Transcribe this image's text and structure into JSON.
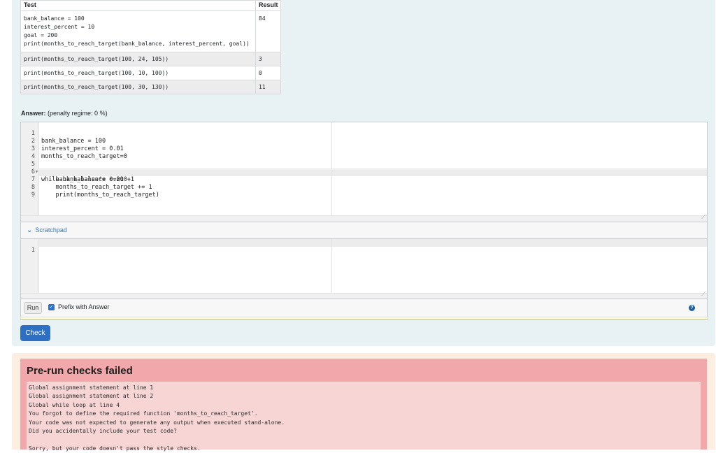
{
  "test_table": {
    "headers": {
      "test": "Test",
      "result": "Result"
    },
    "rows": [
      {
        "test": "bank_balance = 100\ninterest_percent = 10\ngoal = 200\nprint(months_to_reach_target(bank_balance, interest_percent, goal))",
        "result": "84"
      },
      {
        "test": "print(months_to_reach_target(100, 24, 105))",
        "result": "3"
      },
      {
        "test": "print(months_to_reach_target(100, 10, 100))",
        "result": "0"
      },
      {
        "test": "print(months_to_reach_target(100, 30, 130))",
        "result": "11"
      }
    ]
  },
  "answer": {
    "label": "Answer:",
    "penalty": "(penalty regime: 0 %)"
  },
  "editor": {
    "lines": [
      {
        "n": "1",
        "fold": "",
        "text": "bank_balance = 100"
      },
      {
        "n": "2",
        "fold": "",
        "text": "interest_percent = 0.01"
      },
      {
        "n": "3",
        "fold": "",
        "text": "months_to_reach_target=0"
      },
      {
        "n": "4",
        "fold": "",
        "text": ""
      },
      {
        "n": "5",
        "fold": "▾",
        "text": "while bank_balance <=200:"
      },
      {
        "n": "6",
        "fold": "",
        "text": "    bank_balance*= 0.01 +1"
      },
      {
        "n": "7",
        "fold": "",
        "text": "    months_to_reach_target += 1"
      },
      {
        "n": "8",
        "fold": "",
        "text": "    print(months_to_reach_target)"
      },
      {
        "n": "9",
        "fold": "",
        "text": ""
      }
    ]
  },
  "scratchpad": {
    "label": "Scratchpad",
    "line1": "1"
  },
  "controls": {
    "run": "Run",
    "prefix": "Prefix with Answer",
    "help": "?",
    "check": "Check"
  },
  "feedback": {
    "title": "Pre-run checks failed",
    "message": "Global assignment statement at line 1\nGlobal assignment statement at line 2\nGlobal while loop at line 4\nYou forgot to define the required function 'months_to_reach_target'.\nYour code was not expected to generate any output when executed stand-alone.\nDid you accidentally include your test code?\n\nSorry, but your code doesn't pass the style checks."
  },
  "colors": {
    "accent": "#2d6fc2",
    "question_bg": "#e8f2f4",
    "fail_bg": "#f2a8aa"
  },
  "icons": {
    "chevron": "chevron-down-icon",
    "checkbox": "check-icon",
    "help": "help-icon"
  }
}
